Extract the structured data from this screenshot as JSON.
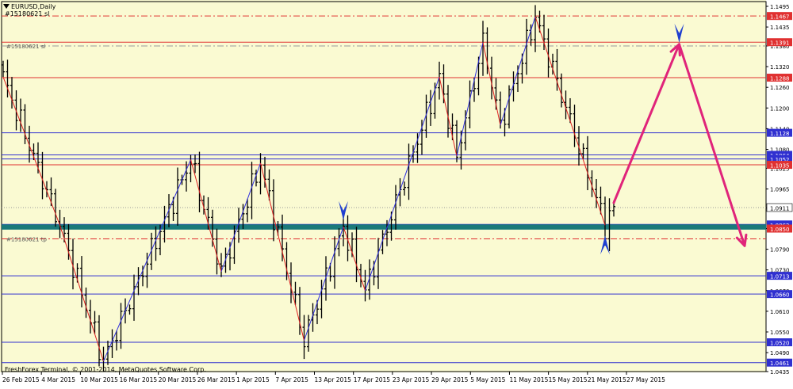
{
  "window": {
    "title": "EURUSD,Daily",
    "subtitle": "#15180621 sl",
    "copyright": "FreshForex Terminal, © 2001-2014, MetaQuotes Software Corp."
  },
  "colors": {
    "background": "#fafad2",
    "bar": "#000000",
    "zigzag_up": "#3030e0",
    "zigzag_down": "#e02020",
    "level_blue": "#3030d0",
    "level_red": "#e03030",
    "support_zone": "#1a7a7a",
    "arrow_magenta": "#e0247a",
    "marker_blue": "#1f3fd0"
  },
  "chart_data": {
    "type": "bar",
    "symbol": "EURUSD",
    "timeframe": "Daily",
    "x_ticks": [
      "26 Feb 2015",
      "4 Mar 2015",
      "10 Mar 2015",
      "16 Mar 2015",
      "20 Mar 2015",
      "26 Mar 2015",
      "1 Apr 2015",
      "7 Apr 2015",
      "13 Apr 2015",
      "17 Apr 2015",
      "23 Apr 2015",
      "29 Apr 2015",
      "5 May 2015",
      "11 May 2015",
      "15 May 2015",
      "21 May 2015",
      "27 May 2015"
    ],
    "y_ticks": [
      "1.1495",
      "1.1435",
      "1.1380",
      "1.1320",
      "1.1260",
      "1.1200",
      "1.1140",
      "1.1080",
      "1.1025",
      "1.0965",
      "1.0910",
      "1.0850",
      "1.0790",
      "1.0730",
      "1.0670",
      "1.0610",
      "1.0550",
      "1.0490",
      "1.0435"
    ],
    "ylim": [
      1.0435,
      1.1495
    ],
    "price_labels": [
      {
        "value": 1.1467,
        "text": "1.1467",
        "color": "red"
      },
      {
        "value": 1.1391,
        "text": "1.1391",
        "color": "red"
      },
      {
        "value": 1.1288,
        "text": "1.1288",
        "color": "red"
      },
      {
        "value": 1.1128,
        "text": "1.1128",
        "color": "blue"
      },
      {
        "value": 1.1064,
        "text": "1.1064",
        "color": "blue"
      },
      {
        "value": 1.1052,
        "text": "1.1052",
        "color": "blue"
      },
      {
        "value": 1.1035,
        "text": "1.1035",
        "color": "red"
      },
      {
        "value": 1.0911,
        "text": "1.0911",
        "color": "white"
      },
      {
        "value": 1.0862,
        "text": "1.0862",
        "color": "blue"
      },
      {
        "value": 1.085,
        "text": "1.0850",
        "color": "red"
      },
      {
        "value": 1.0713,
        "text": "1.0713",
        "color": "blue"
      },
      {
        "value": 1.066,
        "text": "1.0660",
        "color": "blue"
      },
      {
        "value": 1.052,
        "text": "1.0520",
        "color": "blue"
      },
      {
        "value": 1.0461,
        "text": "1.0461",
        "color": "blue"
      }
    ],
    "levels": [
      {
        "value": 1.1467,
        "color": "red",
        "style": "dashdot"
      },
      {
        "value": 1.1391,
        "color": "red",
        "style": "solid"
      },
      {
        "value": 1.138,
        "color": "gray",
        "style": "dashdot"
      },
      {
        "value": 1.1288,
        "color": "red",
        "style": "solid"
      },
      {
        "value": 1.1128,
        "color": "blue",
        "style": "solid"
      },
      {
        "value": 1.1064,
        "color": "blue",
        "style": "solid"
      },
      {
        "value": 1.1052,
        "color": "blue",
        "style": "solid"
      },
      {
        "value": 1.1035,
        "color": "red",
        "style": "solid"
      },
      {
        "value": 1.0911,
        "color": "gray",
        "style": "dotted"
      },
      {
        "value": 1.0862,
        "color": "blue",
        "style": "solid"
      },
      {
        "value": 1.082,
        "color": "red",
        "style": "dashdot"
      },
      {
        "value": 1.0713,
        "color": "blue",
        "style": "solid"
      },
      {
        "value": 1.066,
        "color": "blue",
        "style": "solid"
      },
      {
        "value": 1.052,
        "color": "blue",
        "style": "solid"
      },
      {
        "value": 1.0461,
        "color": "blue",
        "style": "solid"
      }
    ],
    "support_zone": [
      1.0847,
      1.0862
    ],
    "order_labels": [
      {
        "text": "#15180621 sl",
        "value": 1.138
      },
      {
        "text": "#15180621 tp",
        "value": 1.082
      }
    ],
    "zigzag": [
      {
        "t": 0,
        "p": 1.129
      },
      {
        "t": 13,
        "p": 1.086
      },
      {
        "t": 23,
        "p": 1.0465
      },
      {
        "t": 43,
        "p": 1.105
      },
      {
        "t": 50,
        "p": 1.0725
      },
      {
        "t": 59,
        "p": 1.104
      },
      {
        "t": 69,
        "p": 1.0525
      },
      {
        "t": 78,
        "p": 1.0855
      },
      {
        "t": 83,
        "p": 1.067
      },
      {
        "t": 100,
        "p": 1.129
      },
      {
        "t": 104,
        "p": 1.106
      },
      {
        "t": 110,
        "p": 1.139
      },
      {
        "t": 114,
        "p": 1.115
      },
      {
        "t": 122,
        "p": 1.1465
      },
      {
        "t": 138,
        "p": 1.086
      }
    ],
    "projection_arrows": [
      {
        "from": {
          "t": 140,
          "p": 1.0925
        },
        "to": {
          "t": 155,
          "p": 1.1385
        }
      },
      {
        "from": {
          "t": 155,
          "p": 1.1385
        },
        "to": {
          "t": 170,
          "p": 1.08
        }
      }
    ],
    "markers": [
      {
        "t": 78,
        "p": 1.087,
        "dir": "down"
      },
      {
        "t": 155,
        "p": 1.1385,
        "dir": "down"
      },
      {
        "t": 138,
        "p": 1.083,
        "dir": "up"
      }
    ]
  }
}
